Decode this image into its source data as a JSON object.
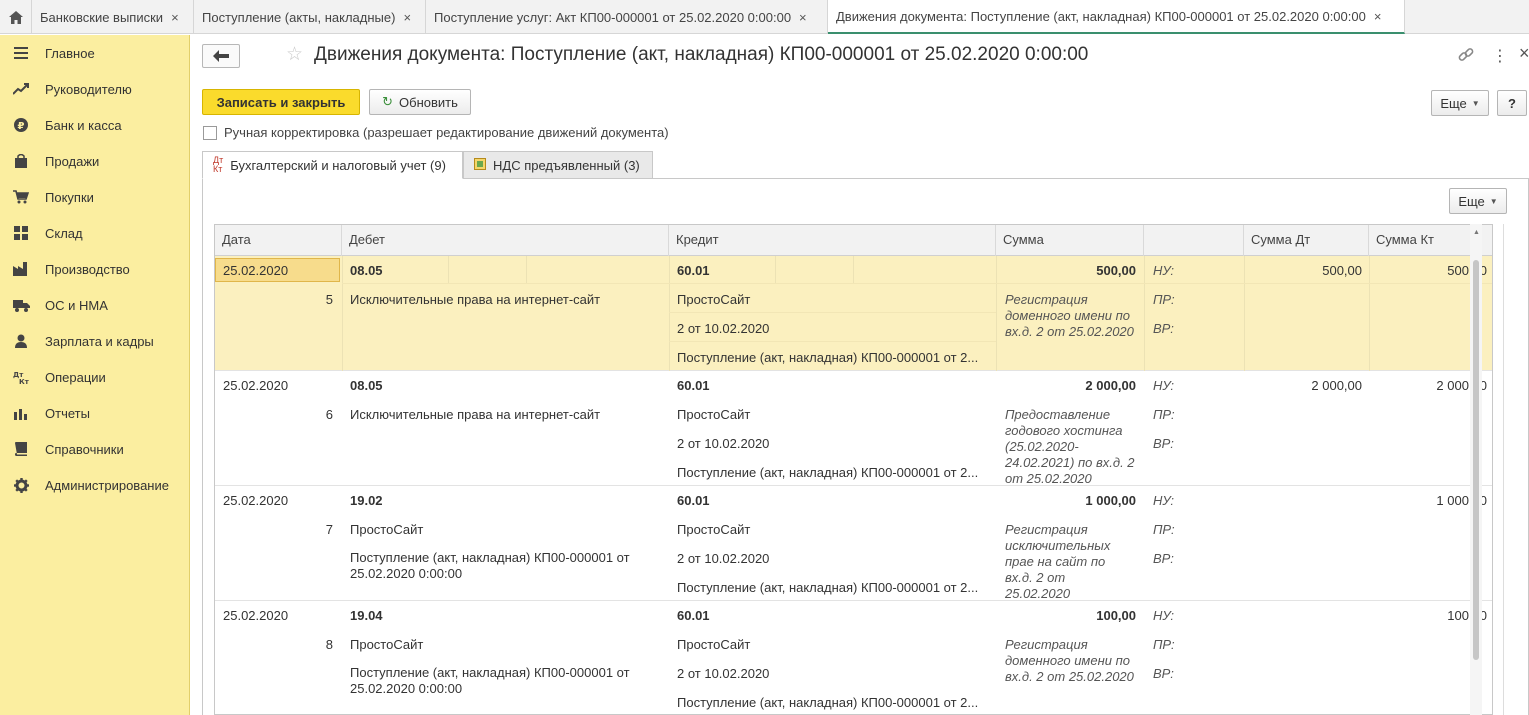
{
  "tabs": [
    {
      "title": "Банковские выписки"
    },
    {
      "title": "Поступление (акты, накладные)"
    },
    {
      "title": "Поступление услуг: Акт КП00-000001 от 25.02.2020 0:00:00"
    },
    {
      "title": "Движения документа: Поступление (акт, накладная) КП00-000001 от 25.02.2020 0:00:00"
    }
  ],
  "tab_close_glyph": "×",
  "sidebar": {
    "items": [
      {
        "label": "Главное",
        "icon": "menu-icon"
      },
      {
        "label": "Руководителю",
        "icon": "trend-icon"
      },
      {
        "label": "Банк и касса",
        "icon": "ruble-icon"
      },
      {
        "label": "Продажи",
        "icon": "bag-icon"
      },
      {
        "label": "Покупки",
        "icon": "cart-icon"
      },
      {
        "label": "Склад",
        "icon": "grid-icon"
      },
      {
        "label": "Производство",
        "icon": "factory-icon"
      },
      {
        "label": "ОС и НМА",
        "icon": "truck-icon"
      },
      {
        "label": "Зарплата и кадры",
        "icon": "person-icon"
      },
      {
        "label": "Операции",
        "icon": "dt-kt-icon"
      },
      {
        "label": "Отчеты",
        "icon": "bar-chart-icon"
      },
      {
        "label": "Справочники",
        "icon": "book-icon"
      },
      {
        "label": "Администрирование",
        "icon": "gear-icon"
      }
    ]
  },
  "header": {
    "title": "Движения документа: Поступление (акт, накладная) КП00-000001 от 25.02.2020 0:00:00"
  },
  "toolbar": {
    "save_close": "Записать и закрыть",
    "refresh": "Обновить",
    "more": "Еще",
    "help": "?"
  },
  "manual_correction": {
    "label": "Ручная корректировка (разрешает редактирование движений документа)",
    "checked": false
  },
  "subtabs": [
    {
      "label": "Бухгалтерский и налоговый учет (9)",
      "icon_top": "Дт",
      "icon_bottom": "Кт"
    },
    {
      "label": "НДС предъявленный (3)"
    }
  ],
  "panel": {
    "more": "Еще"
  },
  "table": {
    "columns": [
      "Дата",
      "Дебет",
      "Кредит",
      "Сумма",
      "",
      "Сумма Дт",
      "Сумма Кт"
    ],
    "rows": [
      {
        "date": "25.02.2020",
        "num": "5",
        "debit_account": "08.05",
        "debit_sub1": "Исключительные права на интернет-сайт",
        "debit_sub2": "",
        "credit_account": "60.01",
        "credit_sub1": "ПростоСайт",
        "credit_sub2": "2 от 10.02.2020",
        "credit_sub3": "Поступление (акт, накладная) КП00-000001 от 2...",
        "amount": "500,00",
        "content": "Регистрация доменного имени по вх.д. 2 от 25.02.2020",
        "nu": "НУ:",
        "pr": "ПР:",
        "vr": "ВР:",
        "sum_dt": "500,00",
        "sum_kt": "500,00"
      },
      {
        "date": "25.02.2020",
        "num": "6",
        "debit_account": "08.05",
        "debit_sub1": "Исключительные права на интернет-сайт",
        "debit_sub2": "",
        "credit_account": "60.01",
        "credit_sub1": "ПростоСайт",
        "credit_sub2": "2 от 10.02.2020",
        "credit_sub3": "Поступление (акт, накладная) КП00-000001 от 2...",
        "amount": "2 000,00",
        "content": "Предоставление годового хостинга (25.02.2020-24.02.2021) по вх.д. 2 от 25.02.2020",
        "nu": "НУ:",
        "pr": "ПР:",
        "vr": "ВР:",
        "sum_dt": "2 000,00",
        "sum_kt": "2 000,00"
      },
      {
        "date": "25.02.2020",
        "num": "7",
        "debit_account": "19.02",
        "debit_sub1": "ПростоСайт",
        "debit_sub2": "Поступление (акт, накладная) КП00-000001 от 25.02.2020 0:00:00",
        "credit_account": "60.01",
        "credit_sub1": "ПростоСайт",
        "credit_sub2": "2 от 10.02.2020",
        "credit_sub3": "Поступление (акт, накладная) КП00-000001 от 2...",
        "amount": "1 000,00",
        "content": "Регистрация исключительных прае на сайт по вх.д. 2 от 25.02.2020",
        "nu": "НУ:",
        "pr": "ПР:",
        "vr": "ВР:",
        "sum_dt": "",
        "sum_kt": "1 000,00"
      },
      {
        "date": "25.02.2020",
        "num": "8",
        "debit_account": "19.04",
        "debit_sub1": "ПростоСайт",
        "debit_sub2": "Поступление (акт, накладная) КП00-000001 от 25.02.2020 0:00:00",
        "credit_account": "60.01",
        "credit_sub1": "ПростоСайт",
        "credit_sub2": "2 от 10.02.2020",
        "credit_sub3": "Поступление (акт, накладная) КП00-000001 от 2...",
        "amount": "100,00",
        "content": "Регистрация доменного имени по вх.д. 2 от 25.02.2020",
        "nu": "НУ:",
        "pr": "ПР:",
        "vr": "ВР:",
        "sum_dt": "",
        "sum_kt": "100,00"
      }
    ]
  },
  "colors": {
    "sidebar_bg": "#fbeea0",
    "primary_button": "#fadb2c",
    "selected_row": "#fbf0bf",
    "active_tab_underline": "#3a8f6e"
  }
}
